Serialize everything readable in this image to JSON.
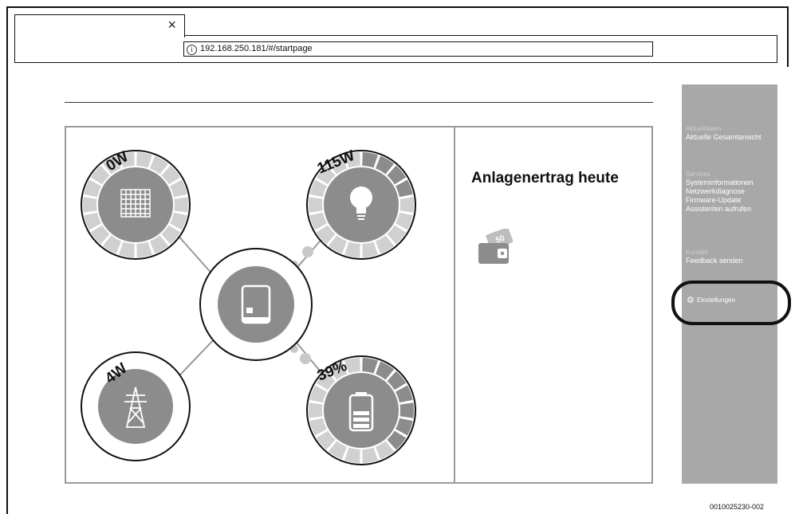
{
  "browser": {
    "close_glyph": "×",
    "url": "192.168.250.181/#/startpage",
    "info_glyph": "i"
  },
  "flow": {
    "solar": {
      "value": "0W",
      "icon": "solar-panel-icon",
      "level": 0.0
    },
    "consumption": {
      "value": "115W",
      "icon": "lightbulb-icon",
      "level": 0.2
    },
    "grid": {
      "value": "4W",
      "icon": "power-pylon-icon",
      "level": 0.0
    },
    "battery": {
      "value": "39%",
      "icon": "battery-icon",
      "level": 0.39
    },
    "inverter": {
      "icon": "inverter-icon"
    }
  },
  "energy": {
    "title": "Anlagenertrag heute",
    "icon": "wallet-money-icon",
    "note_value": "50"
  },
  "sidebar": {
    "groups": [
      {
        "heading": "Aktuelldaten",
        "items": [
          "Aktuelle Gesamtansicht"
        ]
      },
      {
        "heading": "Services",
        "items": [
          "Systeminformationen",
          "Netzwerkdiagnose",
          "Firmware-Update",
          "Assistenten aufrufen"
        ]
      },
      {
        "heading": "Kontakt",
        "items": [
          "Feedback senden"
        ]
      }
    ],
    "settings_label": "Einstellungen",
    "settings_icon": "gear-icon"
  },
  "colors": {
    "gauge_gray": "#8c8c8c",
    "segment_light": "#d0d0d0",
    "segment_active": "#8c8c8c",
    "panel_border": "#9a9a9a",
    "sidebar_bg": "#a8a8a8"
  },
  "figure_id": "0010025230-002"
}
